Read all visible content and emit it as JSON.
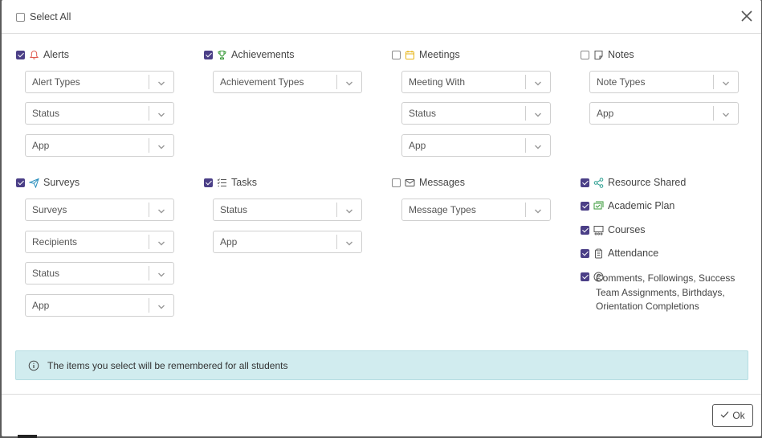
{
  "select_all": {
    "label": "Select All",
    "checked": false
  },
  "sections": [
    {
      "key": "alerts",
      "label": "Alerts",
      "checked": true,
      "icon": "bell-icon",
      "icon_color": "#e05a4f",
      "dropdowns": [
        "Alert Types",
        "Status",
        "App"
      ]
    },
    {
      "key": "achievements",
      "label": "Achievements",
      "checked": true,
      "icon": "trophy-icon",
      "icon_color": "#3a9a3a",
      "dropdowns": [
        "Achievement Types"
      ]
    },
    {
      "key": "meetings",
      "label": "Meetings",
      "checked": false,
      "icon": "calendar-icon",
      "icon_color": "#e7b416",
      "dropdowns": [
        "Meeting With",
        "Status",
        "App"
      ]
    },
    {
      "key": "notes",
      "label": "Notes",
      "checked": false,
      "icon": "note-icon",
      "icon_color": "#555555",
      "dropdowns": [
        "Note Types",
        "App"
      ]
    },
    {
      "key": "surveys",
      "label": "Surveys",
      "checked": true,
      "icon": "paper-plane-icon",
      "icon_color": "#2a8fbd",
      "dropdowns": [
        "Surveys",
        "Recipients",
        "Status",
        "App"
      ]
    },
    {
      "key": "tasks",
      "label": "Tasks",
      "checked": true,
      "icon": "task-list-icon",
      "icon_color": "#555555",
      "dropdowns": [
        "Status",
        "App"
      ]
    },
    {
      "key": "messages",
      "label": "Messages",
      "checked": false,
      "icon": "envelope-icon",
      "icon_color": "#555555",
      "dropdowns": [
        "Message Types"
      ]
    }
  ],
  "extras": [
    {
      "label": "Resource Shared",
      "checked": true,
      "icon": "share-icon",
      "icon_color": "#2a9d8f"
    },
    {
      "label": "Academic Plan",
      "checked": true,
      "icon": "academic-plan-icon",
      "icon_color": "#3a9a3a"
    },
    {
      "label": "Courses",
      "checked": true,
      "icon": "courses-icon",
      "icon_color": "#555555"
    },
    {
      "label": "Attendance",
      "checked": true,
      "icon": "clipboard-icon",
      "icon_color": "#555555"
    },
    {
      "label": "Comments, Followings, Success Team Assignments, Birthdays, Orientation Completions",
      "checked": true,
      "icon": "user-circle-icon",
      "icon_color": "#555555"
    }
  ],
  "info_message": "The items you select will be remembered for all students",
  "ok_label": "Ok",
  "colors": {
    "accent": "#4b3f87",
    "info_bg": "#d1ecef"
  }
}
